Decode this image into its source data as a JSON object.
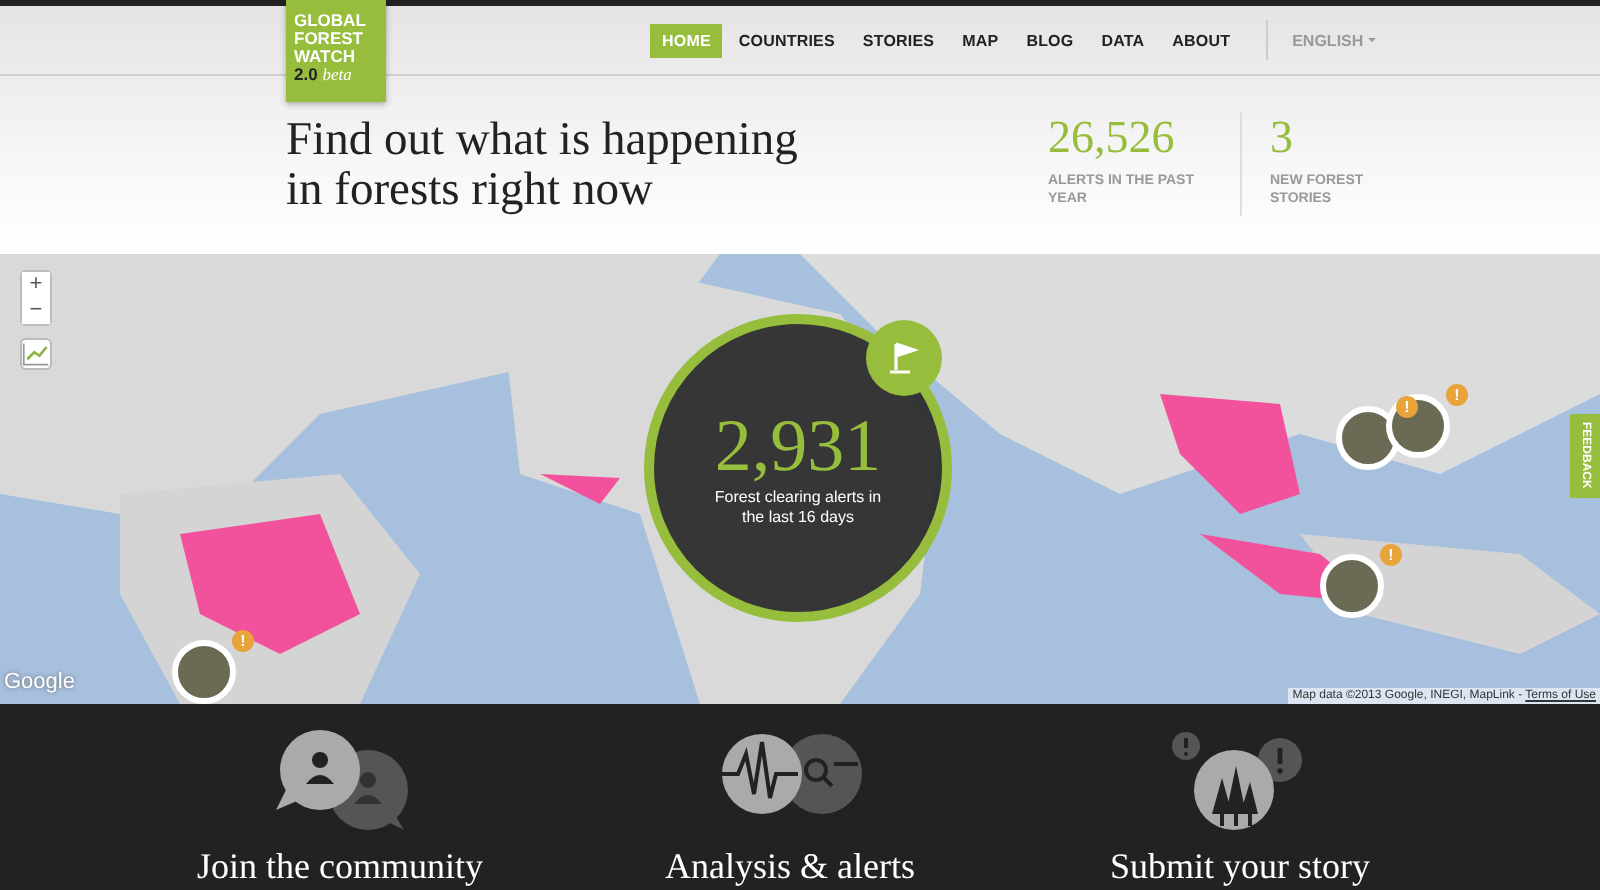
{
  "logo": {
    "lines": [
      "GLOBAL",
      "FOREST",
      "WATCH"
    ],
    "version": "2.0",
    "tag": "beta"
  },
  "nav": [
    {
      "label": "HOME",
      "selected": true
    },
    {
      "label": "COUNTRIES",
      "selected": false
    },
    {
      "label": "STORIES",
      "selected": false
    },
    {
      "label": "MAP",
      "selected": false
    },
    {
      "label": "BLOG",
      "selected": false
    },
    {
      "label": "DATA",
      "selected": false
    },
    {
      "label": "ABOUT",
      "selected": false
    }
  ],
  "language": "ENGLISH",
  "headline_lines": [
    "Find out what is happening",
    "in forests right now"
  ],
  "stats": [
    {
      "value": "26,526",
      "label": "ALERTS IN THE PAST YEAR"
    },
    {
      "value": "3",
      "label": "NEW FOREST STORIES"
    }
  ],
  "map": {
    "zoom_in": "+",
    "zoom_out": "−",
    "alert_count": "2,931",
    "alert_caption": "Forest clearing alerts in the last 16 days",
    "attribution": "Map data ©2013 Google, INEGI, MapLink - ",
    "terms": "Terms of Use",
    "google": "Google",
    "feedback": "FEEDBACK",
    "story_markers": [
      {
        "badge": "!"
      },
      {
        "badge": "!"
      },
      {
        "badge": "!"
      },
      {
        "badge": "!"
      }
    ]
  },
  "features": [
    {
      "kind": "community",
      "title": "Join the community"
    },
    {
      "kind": "analysis",
      "title": "Analysis & alerts"
    },
    {
      "kind": "story",
      "title": "Submit your story"
    }
  ]
}
